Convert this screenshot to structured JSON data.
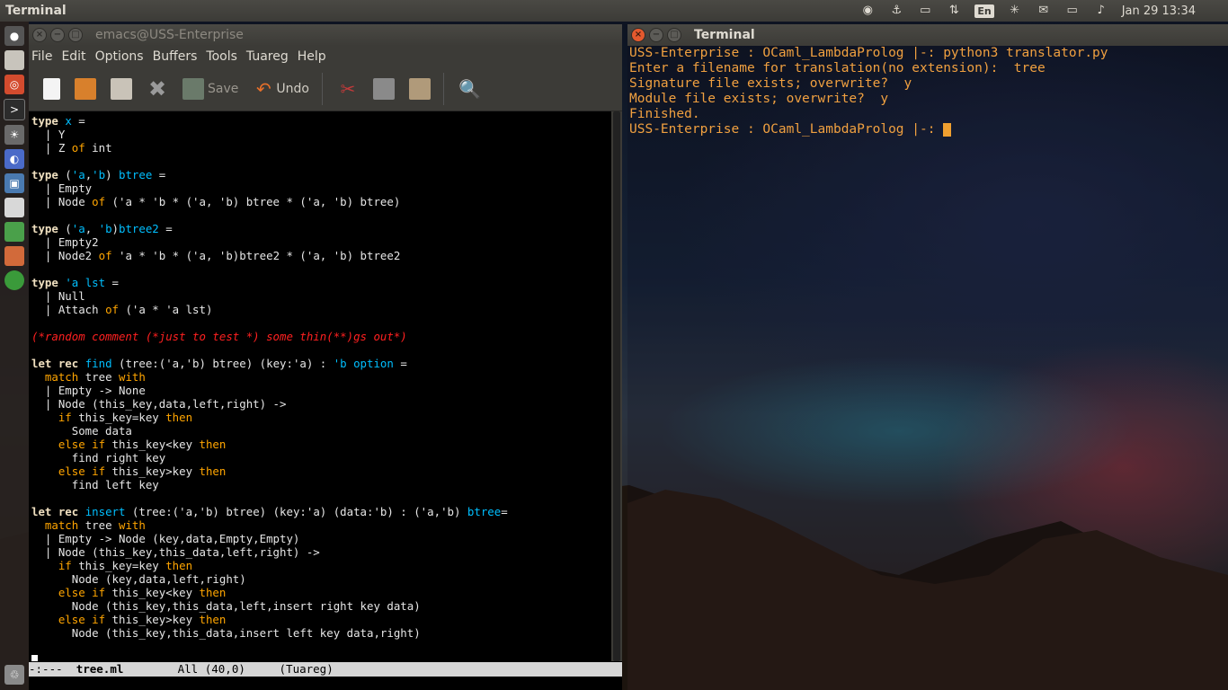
{
  "panel": {
    "title": "Terminal",
    "lang": "En",
    "clock": "Jan 29 13:34"
  },
  "emacs": {
    "title": "emacs@USS-Enterprise",
    "menu": [
      "File",
      "Edit",
      "Options",
      "Buffers",
      "Tools",
      "Tuareg",
      "Help"
    ],
    "toolbar": {
      "save_label": "Save",
      "undo_label": "Undo"
    },
    "modeline": {
      "status": "-:---",
      "filename": "tree.ml",
      "position": "All (40,0)",
      "mode": "(Tuareg)"
    }
  },
  "terminal": {
    "title": "Terminal",
    "lines": [
      "USS-Enterprise : OCaml_LambdaProlog |-: python3 translator.py",
      "Enter a filename for translation(no extension):  tree",
      "Signature file exists; overwrite?  y",
      "Module file exists; overwrite?  y",
      "Finished.",
      "USS-Enterprise : OCaml_LambdaProlog |-: "
    ]
  },
  "colors": {
    "terminal_text": "#f0a040",
    "keyword": "#ffa500",
    "type_name": "#00bfff",
    "comment": "#ff2020"
  },
  "icons": [
    "file-icon",
    "open-folder-icon",
    "dired-icon",
    "close-icon",
    "save-icon",
    "undo-icon",
    "cut-icon",
    "copy-icon",
    "paste-icon",
    "search-icon"
  ]
}
